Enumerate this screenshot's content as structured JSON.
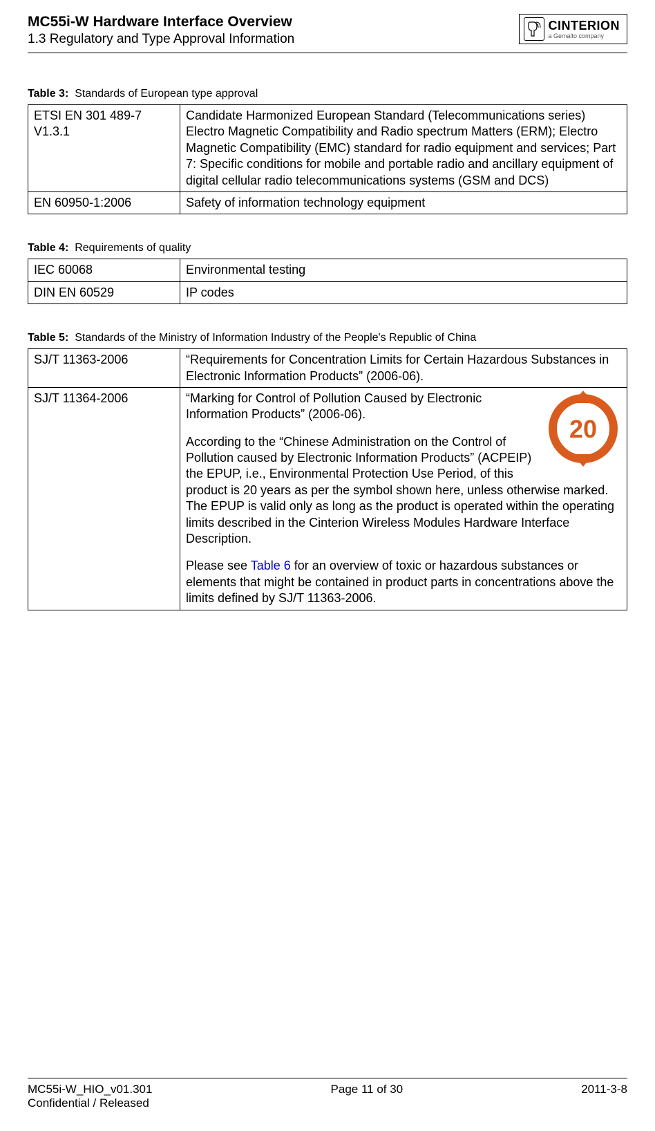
{
  "header": {
    "title": "MC55i-W Hardware Interface Overview",
    "section": "1.3 Regulatory and Type Approval Information",
    "logo_main": "CINTERION",
    "logo_sub": "a Gemalto company"
  },
  "table3": {
    "caption_label": "Table 3:",
    "caption_text": "Standards of European type approval",
    "rows": [
      {
        "c1": "ETSI EN 301 489-7 V1.3.1",
        "c2": "Candidate Harmonized European Standard (Telecommunications series) Electro Magnetic Compatibility and Radio spectrum Matters (ERM); Electro Magnetic Compatibility (EMC) standard for radio equipment and services; Part 7: Specific conditions for mobile and portable radio and ancillary equipment of digital cellular radio telecommunications systems (GSM and DCS)"
      },
      {
        "c1": "EN 60950-1:2006",
        "c2": "Safety of information technology equipment"
      }
    ]
  },
  "table4": {
    "caption_label": "Table 4:",
    "caption_text": "Requirements of quality",
    "rows": [
      {
        "c1": "IEC 60068",
        "c2": "Environmental testing"
      },
      {
        "c1": "DIN EN 60529",
        "c2": "IP codes"
      }
    ]
  },
  "table5": {
    "caption_label": "Table 5:",
    "caption_text": "Standards of the Ministry of Information Industry of the People's Republic of China",
    "rows": [
      {
        "c1": "SJ/T 11363-2006",
        "c2": "“Requirements for Concentration Limits for Certain Hazardous Substances in Electronic Information Products” (2006-06)."
      },
      {
        "c1": "SJ/T 11364-2006",
        "p1": "“Marking for Control of Pollution Caused by Electronic Information Products” (2006-06).",
        "p2": "According to the “Chinese Administration on the Control of Pollution caused by Electronic Information Products” (ACPEIP) the EPUP, i.e., Environmental Protection Use Period, of this product is 20 years as per the symbol shown here, unless otherwise marked. The EPUP is valid only as long as the product is operated within the operating limits described in the Cinterion Wireless Modules Hardware Interface Description.",
        "p3a": "Please see ",
        "p3link": "Table 6",
        "p3b": " for an overview of toxic or hazardous substances or elements that might be contained in product parts in concentrations above the limits defined by SJ/T 11363-2006.",
        "epup_value": "20"
      }
    ]
  },
  "footer": {
    "doc_id": "MC55i-W_HIO_v01.301",
    "confidential": "Confidential / Released",
    "page": "Page 11 of 30",
    "date": "2011-3-8"
  }
}
